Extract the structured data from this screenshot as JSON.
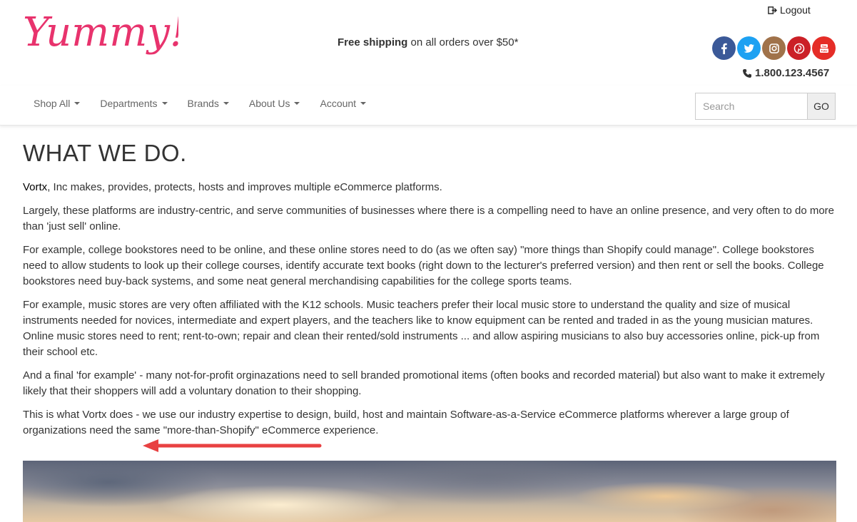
{
  "header": {
    "logo_text": "Yummy!",
    "shipping_bold": "Free shipping",
    "shipping_rest": " on all orders over $50*",
    "logout_label": "Logout",
    "phone": "1.800.123.4567",
    "social": [
      {
        "name": "facebook",
        "color": "#3b5998",
        "glyph": "f"
      },
      {
        "name": "twitter",
        "color": "#1da1f2",
        "glyph": "t"
      },
      {
        "name": "instagram",
        "color": "#a0724a",
        "glyph": "i"
      },
      {
        "name": "pinterest",
        "color": "#cb2027",
        "glyph": "p"
      },
      {
        "name": "youtube",
        "color": "#e52d27",
        "glyph": "You Tube"
      }
    ]
  },
  "nav": {
    "items": [
      "Shop All",
      "Departments",
      "Brands",
      "About Us",
      "Account"
    ]
  },
  "search": {
    "placeholder": "Search",
    "button_label": "GO"
  },
  "main": {
    "heading": "WHAT WE DO.",
    "p1_brand": "Vortx",
    "p1_rest": ", Inc makes, provides, protects, hosts and improves multiple eCommerce platforms.",
    "p2": "Largely, these platforms are industry-centric, and serve communities of businesses where there is a compelling need to have an online presence, and very often to do more than 'just sell' online.",
    "p3": "For example, college bookstores need to be online, and these online stores need to do (as we often say) \"more things than Shopify could manage\". College bookstores need to allow students to look up their college courses, identify accurate text books (right down to the lecturer's preferred version) and then rent or sell the books. College bookstores need buy-back systems, and some neat general merchandising capabilities for the college sports teams.",
    "p4": "For example, music stores are very often affiliated with the K12 schools. Music teachers prefer their local music store to understand the quality and size of musical instruments needed for novices, intermediate and expert players, and the teachers like to know equipment can be rented and traded in as the young musician matures. Online music stores need to rent; rent-to-own; repair and clean their rented/sold instruments ... and allow aspiring musicians to also buy accessories online, pick-up from their school etc.",
    "p5": "And a final 'for example' - many not-for-profit orginazations need to sell branded promotional items (often books and recorded material) but also want to make it extremely likely that their shoppers will add a voluntary donation to their shopping.",
    "p6": "This is what Vortx does - we use our industry expertise to design, build, host and maintain Software-as-a-Service eCommerce platforms wherever a large group of organizations need the same \"more-than-Shopify\" eCommerce experience."
  },
  "colors": {
    "logo": "#e8336d",
    "arrow": "#e84142"
  }
}
